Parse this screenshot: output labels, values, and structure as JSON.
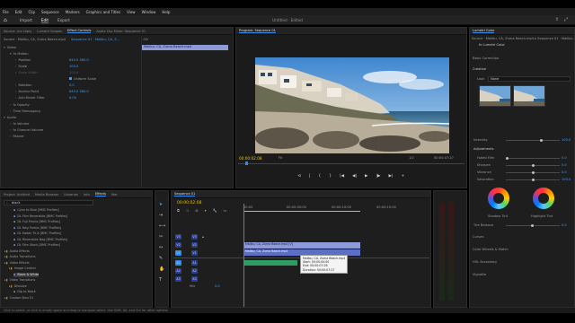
{
  "menubar": [
    "File",
    "Edit",
    "Clip",
    "Sequence",
    "Markers",
    "Graphics and Titles",
    "View",
    "Window",
    "Help"
  ],
  "workspace": {
    "tabs": [
      "Import",
      "Edit",
      "Export"
    ],
    "active": "Edit",
    "title": "Untitled · Edited"
  },
  "effect_controls": {
    "tabs": [
      "Source: (no clips)",
      "Lumetri Scopes",
      "Effect Controls",
      "Audio Clip Mixer: Sequence 01"
    ],
    "active_tab": "Effect Controls",
    "header_source": "Source · Malibu, CA, Zuma Beach.mp4",
    "header_seq": "Sequence 01 · Malibu, CA, Z...",
    "clip_label": ":00",
    "clip_bar": "Malibu, CA, Zuma Beach.mp4",
    "rows": [
      {
        "label": "Video",
        "value": ""
      },
      {
        "label": "fx Motion",
        "value": ""
      },
      {
        "label": "Position",
        "value": "640.0   360.0"
      },
      {
        "label": "Scale",
        "value": "100.0"
      },
      {
        "label": "Scale Width",
        "value": "100.0"
      },
      {
        "label": "Uniform Scale",
        "value": ""
      },
      {
        "label": "Rotation",
        "value": "0.0"
      },
      {
        "label": "Anchor Point",
        "value": "640.0   360.0"
      },
      {
        "label": "Anti-flicker Filter",
        "value": "0.00"
      },
      {
        "label": "fx Opacity",
        "value": ""
      },
      {
        "label": "Time Remapping",
        "value": ""
      },
      {
        "label": "Audio",
        "value": ""
      },
      {
        "label": "fx Volume",
        "value": ""
      },
      {
        "label": "fx Channel Volume",
        "value": ""
      },
      {
        "label": "Panner",
        "value": ""
      }
    ]
  },
  "program": {
    "title": "Program: Sequence 01",
    "timecode": "00:00:02:08",
    "fit": "Fit",
    "quality": "1/2",
    "duration": "00:00:07:27",
    "transport": [
      "⊲",
      "|",
      "{",
      "}",
      "|◀",
      "◀|",
      "▶",
      "|▶",
      "▶|",
      "+"
    ]
  },
  "lumetri": {
    "tab": "Lumetri Color",
    "header": "Source · Malibu, CA, Zuma Beach.mp4 ▸ Sequence 01 · Malibu...",
    "sub": "fx  Lumetri Color",
    "sections": [
      "Basic Correction",
      "Creative"
    ],
    "look_label": "Look",
    "look_value": "None",
    "intensity": {
      "label": "Intensity",
      "value": "100.0"
    },
    "adjustments": "Adjustments",
    "sliders": [
      {
        "label": "Faded Film",
        "value": "0.0",
        "level": 0.0
      },
      {
        "label": "Sharpen",
        "value": "0.0",
        "level": 0.5
      },
      {
        "label": "Vibrance",
        "value": "0.0",
        "level": 0.5
      },
      {
        "label": "Saturation",
        "value": "100.0",
        "level": 0.5
      }
    ],
    "wheels": [
      "Shadow Tint",
      "Highlight Tint"
    ],
    "tint_balance": {
      "label": "Tint Balance",
      "value": "0.0"
    },
    "more_sections": [
      "Curves",
      "Color Wheels & Match",
      "HSL Secondary",
      "Vignette"
    ]
  },
  "effects_panel": {
    "tabs": [
      "Project: Untitled",
      "Media Browser",
      "Libraries",
      "Info",
      "Effects",
      "Mar"
    ],
    "active_tab": "Effects",
    "search": "black",
    "items": [
      {
        "label": "Cyan to Blue [BMC Profiles]",
        "indent": 2
      },
      {
        "label": "DL Film Reversible [BMC Profiles]",
        "indent": 2
      },
      {
        "label": "DL Fuji Provia [BMC Profiles]",
        "indent": 2
      },
      {
        "label": "DL Neg Forma [BMC Profiles]",
        "indent": 2
      },
      {
        "label": "DL Kodak Tri-X [BMC Profiles]",
        "indent": 2
      },
      {
        "label": "DL Reversible Neg [BMC Profiles]",
        "indent": 2
      },
      {
        "label": "DL Film Stock [BMC Profiles]",
        "indent": 2
      },
      {
        "label": "Audio Effects",
        "indent": 0
      },
      {
        "label": "Audio Transitions",
        "indent": 0
      },
      {
        "label": "Video Effects",
        "indent": 0
      },
      {
        "label": "Image Control",
        "indent": 1
      },
      {
        "label": "Black & White",
        "indent": 2
      },
      {
        "label": "Video Transitions",
        "indent": 0
      },
      {
        "label": "Dissolve",
        "indent": 1
      },
      {
        "label": "Dip to Black",
        "indent": 2
      },
      {
        "label": "Custom Bins 01",
        "indent": 0
      }
    ]
  },
  "timeline": {
    "tab": "Sequence 01",
    "timecode": "00:00:02:08",
    "ruler": [
      "00:00",
      "00:00:05:00",
      "00:00:10:00",
      "00:00:15:00"
    ],
    "tracks_video": [
      "V3",
      "V2",
      "V1"
    ],
    "tracks_audio": [
      "A1",
      "A2",
      "A3"
    ],
    "mix": "Mix",
    "mix_value": "0.0",
    "clip_video": "Malibu, CA, Zuma Beach.mp4 [V]",
    "clip_audio": "Malibu, CA, Zuma Beach.mp4",
    "tooltip": [
      "Malibu, CA, Zuma Beach.mp4",
      "Start: 00:00:00:00",
      "End: 00:00:07:26",
      "Duration: 00:00:07:27"
    ]
  },
  "status": "Click to select, or click in empty space and drag to marquee select. Use Shift, Alt, and Ctrl for other options."
}
